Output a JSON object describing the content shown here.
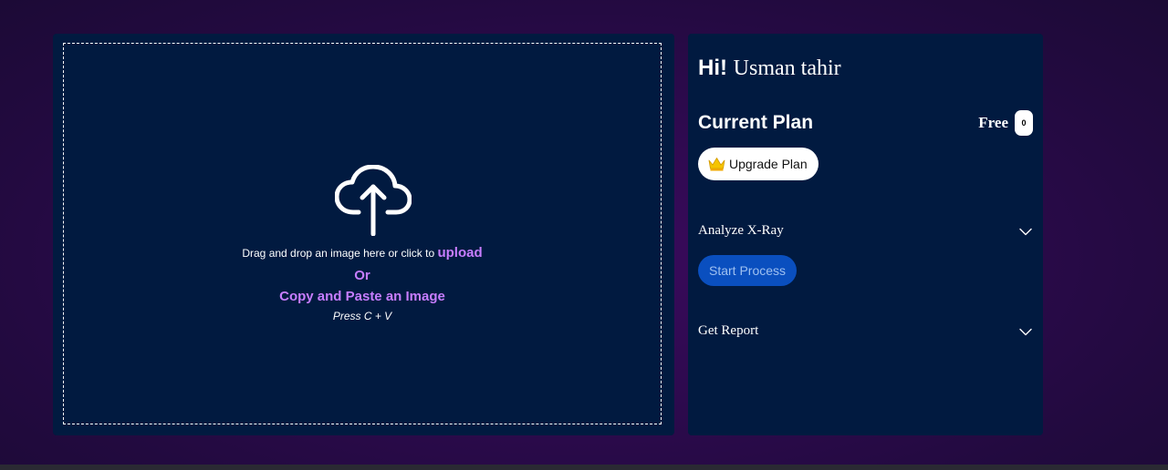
{
  "upload": {
    "drop_text": "Drag and drop an image here or click to ",
    "upload_link": "upload",
    "or_text": "Or",
    "paste_text": "Copy and Paste an Image",
    "shortcut_text": "Press C + V"
  },
  "sidebar": {
    "greeting_hi": "Hi!",
    "user_name": "Usman tahir",
    "plan_heading": "Current Plan",
    "plan_name": "Free",
    "credits": "0",
    "upgrade_label": "Upgrade Plan",
    "sections": [
      {
        "label": "Analyze X-Ray",
        "action_label": "Start Process"
      },
      {
        "label": "Get Report"
      }
    ]
  },
  "icons": {
    "upload": "cloud-upload-icon",
    "crown": "crown-icon",
    "chevron": "chevron-down-icon"
  },
  "colors": {
    "panel_bg": "#011a40",
    "accent_purple": "#c77dff",
    "button_blue": "#0a4fbf",
    "background": "#2d0a4e"
  }
}
